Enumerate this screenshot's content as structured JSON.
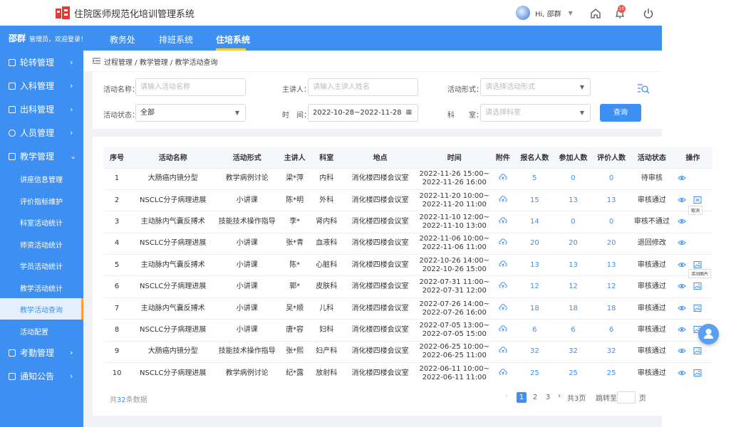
{
  "header": {
    "app_title": "住院医师规范化培训管理系统",
    "greeting": "Hi, 邵群",
    "notification_count": "10"
  },
  "navbar": {
    "user_name": "邵群",
    "role_text": "管理员，欢迎登录！",
    "tabs": [
      {
        "label": "教务处",
        "active": false
      },
      {
        "label": "排班系统",
        "active": false
      },
      {
        "label": "住培系统",
        "active": true
      }
    ]
  },
  "sidebar": {
    "items": [
      {
        "label": "轮转管理"
      },
      {
        "label": "入科管理"
      },
      {
        "label": "出科管理"
      },
      {
        "label": "人员管理"
      },
      {
        "label": "教学管理",
        "expanded": true
      },
      {
        "label": "考勤管理"
      },
      {
        "label": "通知公告"
      }
    ],
    "sub_items": [
      {
        "label": "讲座信息管理"
      },
      {
        "label": "评价指标维护"
      },
      {
        "label": "科室活动统计"
      },
      {
        "label": "师资活动统计"
      },
      {
        "label": "学员活动统计"
      },
      {
        "label": "教学活动统计"
      },
      {
        "label": "教学活动查询",
        "active": true
      },
      {
        "label": "活动配置"
      }
    ]
  },
  "breadcrumb": "过程管理 / 教学管理 / 教学活动查询",
  "filters": {
    "activity_name_label": "活动名称：",
    "activity_name_placeholder": "请输入活动名称",
    "lecturer_label": "主讲人：",
    "lecturer_placeholder": "请输入主讲人姓名",
    "form_label": "活动形式：",
    "form_placeholder": "请选择活动形式",
    "status_label": "活动状态：",
    "status_value": "全部",
    "time_label": "时　间：",
    "time_value": "2022-10-28~2022-11-28",
    "dept_label": "科　　室：",
    "dept_placeholder": "请选择科室",
    "query_button": "查询"
  },
  "table": {
    "headers": [
      "序号",
      "活动名称",
      "活动形式",
      "主讲人",
      "科室",
      "地点",
      "时间",
      "附件",
      "报名人数",
      "参加人数",
      "评价人数",
      "活动状态",
      "操作"
    ],
    "rows": [
      {
        "no": "1",
        "name": "大肠癌内镜分型",
        "form": "教学病例讨论",
        "lecturer": "梁*萍",
        "dept": "内科",
        "place": "消化楼四楼会议室",
        "time1": "2022-11-26 15:00~",
        "time2": "2022-11-26 16:00",
        "signup": "5",
        "attend": "0",
        "eval": "0",
        "status": "待审核",
        "ops": [
          "view"
        ]
      },
      {
        "no": "2",
        "name": "NSCLC分子病理进展",
        "form": "小讲课",
        "lecturer": "陈*明",
        "dept": "外科",
        "place": "消化楼四楼会议室",
        "time1": "2022-11-20 10:00~",
        "time2": "2022-11-20 11:00",
        "signup": "15",
        "attend": "13",
        "eval": "13",
        "status": "审核通过",
        "ops": [
          "view",
          "cancel"
        ]
      },
      {
        "no": "3",
        "name": "主动脉内气囊反搏术",
        "form": "技能技术操作指导",
        "lecturer": "李*",
        "dept": "肾内科",
        "place": "消化楼四楼会议室",
        "time1": "2022-11-10 12:00~",
        "time2": "2022-11-10 13:00",
        "signup": "14",
        "attend": "0",
        "eval": "0",
        "status": "审核不通过",
        "ops": [
          "view"
        ]
      },
      {
        "no": "4",
        "name": "NSCLC分子病理进展",
        "form": "小讲课",
        "lecturer": "张*青",
        "dept": "血液科",
        "place": "消化楼四楼会议室",
        "time1": "2022-11-06 10:00~",
        "time2": "2022-11-06 11:00",
        "signup": "20",
        "attend": "20",
        "eval": "20",
        "status": "退回修改",
        "ops": [
          "view"
        ]
      },
      {
        "no": "5",
        "name": "主动脉内气囊反搏术",
        "form": "小讲课",
        "lecturer": "陈*",
        "dept": "心脏科",
        "place": "消化楼四楼会议室",
        "time1": "2022-10-26 14:00~",
        "time2": "2022-10-26 15:00",
        "signup": "13",
        "attend": "13",
        "eval": "13",
        "status": "审核通过",
        "ops": [
          "view",
          "image"
        ]
      },
      {
        "no": "6",
        "name": "NSCLC分子病理进展",
        "form": "小讲课",
        "lecturer": "郭*",
        "dept": "皮肤科",
        "place": "消化楼四楼会议室",
        "time1": "2022-07-31 11:00~",
        "time2": "2022-07-31 12:00",
        "signup": "12",
        "attend": "12",
        "eval": "12",
        "status": "审核通过",
        "ops": [
          "view",
          "image"
        ]
      },
      {
        "no": "7",
        "name": "主动脉内气囊反搏术",
        "form": "小讲课",
        "lecturer": "吴*顺",
        "dept": "儿科",
        "place": "消化楼四楼会议室",
        "time1": "2022-07-26 14:00~",
        "time2": "2022-07-26 16:00",
        "signup": "18",
        "attend": "18",
        "eval": "18",
        "status": "审核通过",
        "ops": [
          "view",
          "image"
        ]
      },
      {
        "no": "8",
        "name": "NSCLC分子病理进展",
        "form": "小讲课",
        "lecturer": "唐*容",
        "dept": "妇科",
        "place": "消化楼四楼会议室",
        "time1": "2022-07-05 13:00~",
        "time2": "2022-07-05 15:00",
        "signup": "6",
        "attend": "6",
        "eval": "6",
        "status": "审核通过",
        "ops": [
          "view",
          "image"
        ]
      },
      {
        "no": "9",
        "name": "大肠癌内镜分型",
        "form": "技能技术操作指导",
        "lecturer": "张*熙",
        "dept": "妇产科",
        "place": "消化楼四楼会议室",
        "time1": "2022-06-25 10:00~",
        "time2": "2022-06-25 11:00",
        "signup": "32",
        "attend": "32",
        "eval": "32",
        "status": "审核通过",
        "ops": [
          "view",
          "image"
        ]
      },
      {
        "no": "10",
        "name": "NSCLC分子病理进展",
        "form": "教学病例讨论",
        "lecturer": "纪*露",
        "dept": "放射科",
        "place": "消化楼四楼会议室",
        "time1": "2022-06-11 10:00~",
        "time2": "2022-06-11 11:00",
        "signup": "25",
        "attend": "25",
        "eval": "25",
        "status": "审核通过",
        "ops": [
          "view",
          "image"
        ]
      }
    ],
    "tooltips": {
      "cancel": "取消",
      "image": "活动图片"
    }
  },
  "pagination": {
    "total_prefix": "共",
    "total_count": "32",
    "total_suffix": "条数据",
    "pages": [
      "1",
      "2",
      "3"
    ],
    "current_page": "1",
    "total_pages_text": "共3页",
    "jump_label": "跳转至",
    "page_unit": "页"
  },
  "colors": {
    "primary": "#3d8ff2",
    "accent": "#ffcc33",
    "badge": "#f05454"
  }
}
